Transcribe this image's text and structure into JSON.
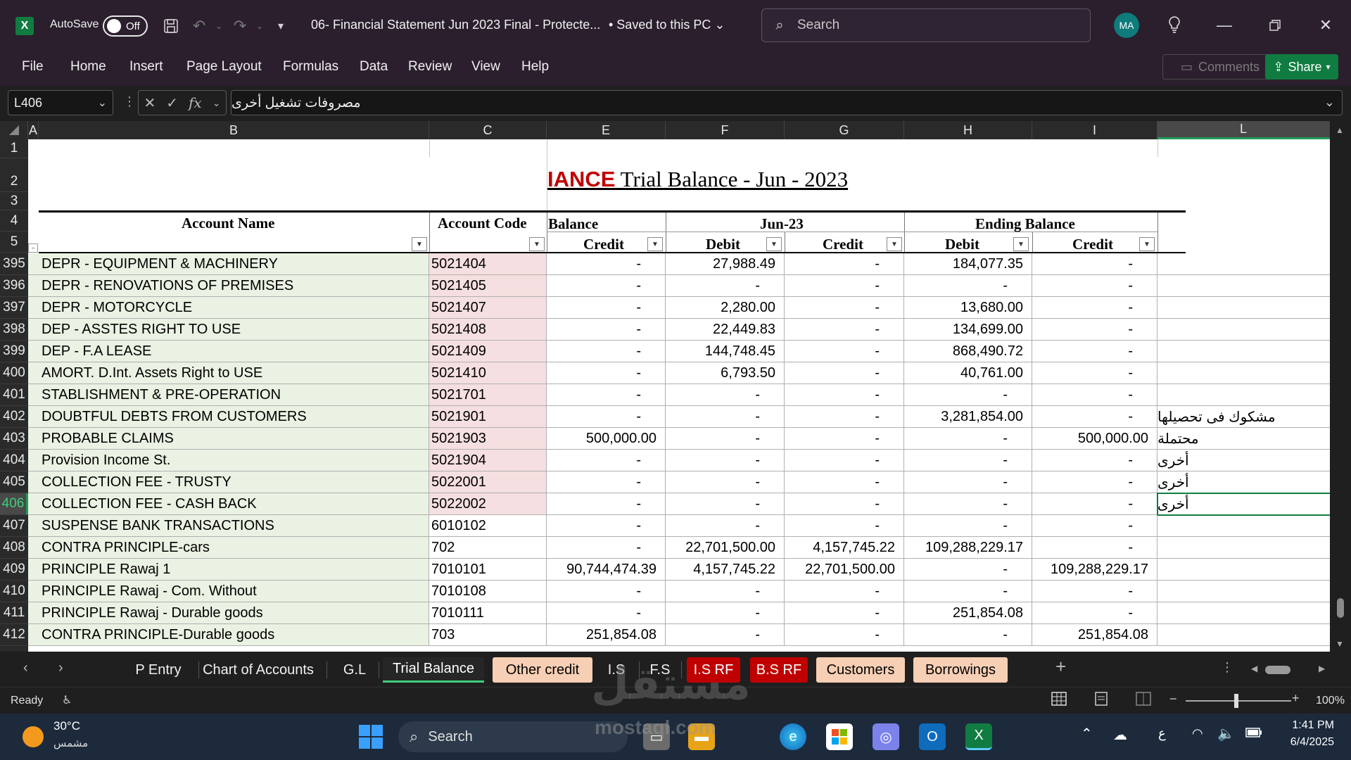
{
  "titlebar": {
    "app_logo": "X",
    "autosave_label": "AutoSave",
    "autosave_state": "Off",
    "doc_title": "06- Financial Statement Jun 2023 Final  -  Protecte...",
    "saved_status": "• Saved to this PC",
    "search_placeholder": "Search",
    "avatar_initials": "MA"
  },
  "ribbon": {
    "tabs": [
      "File",
      "Home",
      "Insert",
      "Page Layout",
      "Formulas",
      "Data",
      "Review",
      "View",
      "Help"
    ],
    "comments_label": "Comments",
    "share_label": "Share"
  },
  "formula_bar": {
    "name_box": "L406",
    "fx": "fx",
    "content": "مصروفات تشغيل أخرى"
  },
  "columns": [
    "A",
    "B",
    "C",
    "E",
    "F",
    "G",
    "H",
    "I",
    "L"
  ],
  "selected_column": "L",
  "selected_row": "406",
  "header_rows": [
    "1",
    "2",
    "3",
    "4",
    "5"
  ],
  "sheet_title": {
    "prefix": "IANCE",
    "text": " Trial Balance - Jun - 2023"
  },
  "table_headers": {
    "account_name": "Account Name",
    "account_code": "Account Code",
    "balance": "Balance",
    "credit": "Credit",
    "month": "Jun-23",
    "debit": "Debit",
    "ending_balance": "Ending Balance"
  },
  "rows": [
    {
      "row": "395",
      "name": "DEPR - EQUIPMENT & MACHINERY",
      "code": "5021404",
      "e": "-",
      "f": "27,988.49",
      "g": "-",
      "h": "184,077.35",
      "i": "-",
      "l": ""
    },
    {
      "row": "396",
      "name": "DEPR - RENOVATIONS OF PREMISES",
      "code": "5021405",
      "e": "-",
      "f": "-",
      "g": "-",
      "h": "-",
      "i": "-",
      "l": ""
    },
    {
      "row": "397",
      "name": "DEPR - MOTORCYCLE",
      "code": "5021407",
      "e": "-",
      "f": "2,280.00",
      "g": "-",
      "h": "13,680.00",
      "i": "-",
      "l": ""
    },
    {
      "row": "398",
      "name": "DEP - ASSTES RIGHT TO USE",
      "code": "5021408",
      "e": "-",
      "f": "22,449.83",
      "g": "-",
      "h": "134,699.00",
      "i": "-",
      "l": ""
    },
    {
      "row": "399",
      "name": "DEP - F.A LEASE",
      "code": "5021409",
      "e": "-",
      "f": "144,748.45",
      "g": "-",
      "h": "868,490.72",
      "i": "-",
      "l": ""
    },
    {
      "row": "400",
      "name": "AMORT. D.Int. Assets Right to USE",
      "code": "5021410",
      "e": "-",
      "f": "6,793.50",
      "g": "-",
      "h": "40,761.00",
      "i": "-",
      "l": ""
    },
    {
      "row": "401",
      "name": "STABLISHMENT & PRE-OPERATION",
      "code": "5021701",
      "e": "-",
      "f": "-",
      "g": "-",
      "h": "-",
      "i": "-",
      "l": ""
    },
    {
      "row": "402",
      "name": "DOUBTFUL DEBTS FROM CUSTOMERS",
      "code": "5021901",
      "e": "-",
      "f": "-",
      "g": "-",
      "h": "3,281,854.00",
      "i": "-",
      "l": "مشكوك فى تحصيلها"
    },
    {
      "row": "403",
      "name": "PROBABLE CLAIMS",
      "code": "5021903",
      "e": "500,000.00",
      "f": "-",
      "g": "-",
      "h": "-",
      "i": "500,000.00",
      "l": "محتملة"
    },
    {
      "row": "404",
      "name": "Provision Income St.",
      "code": "5021904",
      "e": "-",
      "f": "-",
      "g": "-",
      "h": "-",
      "i": "-",
      "l": "أخرى"
    },
    {
      "row": "405",
      "name": "COLLECTION FEE - TRUSTY",
      "code": "5022001",
      "e": "-",
      "f": "-",
      "g": "-",
      "h": "-",
      "i": "-",
      "l": "أخرى"
    },
    {
      "row": "406",
      "name": "COLLECTION FEE - CASH BACK",
      "code": "5022002",
      "e": "-",
      "f": "-",
      "g": "-",
      "h": "-",
      "i": "-",
      "l": "أخرى"
    },
    {
      "row": "407",
      "name": "SUSPENSE BANK TRANSACTIONS",
      "code": "6010102",
      "e": "-",
      "f": "-",
      "g": "-",
      "h": "-",
      "i": "-",
      "l": ""
    },
    {
      "row": "408",
      "name": "CONTRA PRINCIPLE-cars",
      "code": "702",
      "e": "-",
      "f": "22,701,500.00",
      "g": "4,157,745.22",
      "h": "109,288,229.17",
      "i": "-",
      "l": ""
    },
    {
      "row": "409",
      "name": "PRINCIPLE Rawaj 1",
      "code": "7010101",
      "e": "90,744,474.39",
      "f": "4,157,745.22",
      "g": "22,701,500.00",
      "h": "-",
      "i": "109,288,229.17",
      "l": ""
    },
    {
      "row": "410",
      "name": "PRINCIPLE Rawaj - Com. Without",
      "code": "7010108",
      "e": "-",
      "f": "-",
      "g": "-",
      "h": "-",
      "i": "-",
      "l": ""
    },
    {
      "row": "411",
      "name": "PRINCIPLE Rawaj - Durable goods",
      "code": "7010111",
      "e": "-",
      "f": "-",
      "g": "-",
      "h": "251,854.08",
      "i": "-",
      "l": ""
    },
    {
      "row": "412",
      "name": "CONTRA PRINCIPLE-Durable goods",
      "code": "703",
      "e": "251,854.08",
      "f": "-",
      "g": "-",
      "h": "-",
      "i": "251,854.08",
      "l": ""
    }
  ],
  "sheet_tabs": [
    {
      "label": "P Entry",
      "style": "plain"
    },
    {
      "label": "Chart of Accounts",
      "style": "plain"
    },
    {
      "label": "G.L",
      "style": "plain"
    },
    {
      "label": "Trial Balance",
      "style": "active"
    },
    {
      "label": "Other credit",
      "style": "peach"
    },
    {
      "label": "I.S",
      "style": "plain"
    },
    {
      "label": "F.S",
      "style": "plain"
    },
    {
      "label": "I.S RF",
      "style": "red"
    },
    {
      "label": "B.S RF",
      "style": "red"
    },
    {
      "label": "Customers",
      "style": "peach"
    },
    {
      "label": "Borrowings",
      "style": "peach"
    }
  ],
  "status": {
    "ready": "Ready",
    "zoom": "100%"
  },
  "taskbar": {
    "temperature": "30°C",
    "weather": "مشمس",
    "search": "Search",
    "lang": "ع",
    "time": "1:41 PM",
    "date": "6/4/2025"
  },
  "watermark": {
    "arabic": "مستقل",
    "latin": "mostaql.com"
  },
  "colors": {
    "title_bar": "#2b1f2e",
    "excel_green": "#107c41",
    "name_column_fill": "#eaf2e3",
    "code_column_fill": "#f6dfe0",
    "tab_peach": "#f7cfb4",
    "tab_red": "#c00000"
  }
}
